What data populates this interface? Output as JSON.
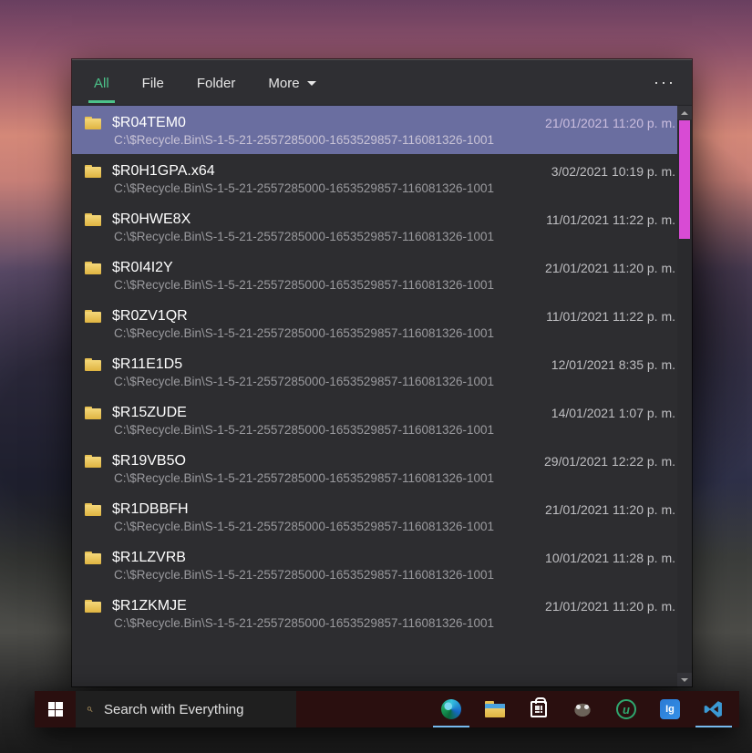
{
  "tabs": {
    "all": "All",
    "file": "File",
    "folder": "Folder",
    "more": "More"
  },
  "morebutton_glyph": "···",
  "results": [
    {
      "name": "$R04TEM0",
      "path": "C:\\$Recycle.Bin\\S-1-5-21-2557285000-1653529857-116081326-1001",
      "date": "21/01/2021 11:20 p. m.",
      "selected": true
    },
    {
      "name": "$R0H1GPA.x64",
      "path": "C:\\$Recycle.Bin\\S-1-5-21-2557285000-1653529857-116081326-1001",
      "date": "3/02/2021 10:19 p. m.",
      "selected": false
    },
    {
      "name": "$R0HWE8X",
      "path": "C:\\$Recycle.Bin\\S-1-5-21-2557285000-1653529857-116081326-1001",
      "date": "11/01/2021 11:22 p. m.",
      "selected": false
    },
    {
      "name": "$R0I4I2Y",
      "path": "C:\\$Recycle.Bin\\S-1-5-21-2557285000-1653529857-116081326-1001",
      "date": "21/01/2021 11:20 p. m.",
      "selected": false
    },
    {
      "name": "$R0ZV1QR",
      "path": "C:\\$Recycle.Bin\\S-1-5-21-2557285000-1653529857-116081326-1001",
      "date": "11/01/2021 11:22 p. m.",
      "selected": false
    },
    {
      "name": "$R11E1D5",
      "path": "C:\\$Recycle.Bin\\S-1-5-21-2557285000-1653529857-116081326-1001",
      "date": "12/01/2021 8:35 p. m.",
      "selected": false
    },
    {
      "name": "$R15ZUDE",
      "path": "C:\\$Recycle.Bin\\S-1-5-21-2557285000-1653529857-116081326-1001",
      "date": "14/01/2021 1:07 p. m.",
      "selected": false
    },
    {
      "name": "$R19VB5O",
      "path": "C:\\$Recycle.Bin\\S-1-5-21-2557285000-1653529857-116081326-1001",
      "date": "29/01/2021 12:22 p. m.",
      "selected": false
    },
    {
      "name": "$R1DBBFH",
      "path": "C:\\$Recycle.Bin\\S-1-5-21-2557285000-1653529857-116081326-1001",
      "date": "21/01/2021 11:20 p. m.",
      "selected": false
    },
    {
      "name": "$R1LZVRB",
      "path": "C:\\$Recycle.Bin\\S-1-5-21-2557285000-1653529857-116081326-1001",
      "date": "10/01/2021 11:28 p. m.",
      "selected": false
    },
    {
      "name": "$R1ZKMJE",
      "path": "C:\\$Recycle.Bin\\S-1-5-21-2557285000-1653529857-116081326-1001",
      "date": "21/01/2021 11:20 p. m.",
      "selected": false
    }
  ],
  "taskbar": {
    "search_placeholder": "Search with Everything",
    "search_value": "",
    "icons": {
      "edge": "edge-browser",
      "explorer": "file-explorer",
      "store": "microsoft-store",
      "gimp": "gimp",
      "utorrent": "utorrent",
      "ig": "igdm",
      "vscode": "vscode"
    },
    "utor_glyph": "u",
    "ig_glyph": "Ig"
  }
}
